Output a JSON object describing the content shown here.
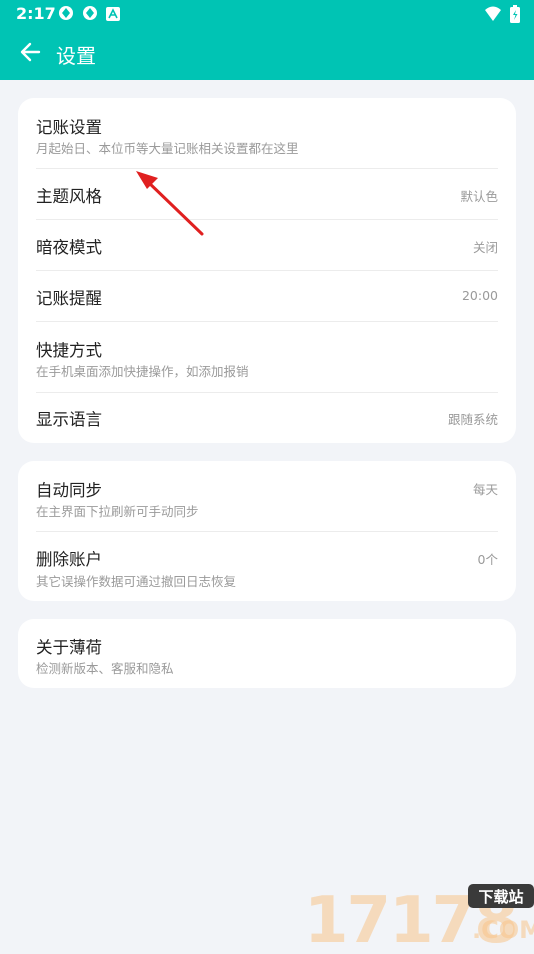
{
  "status_bar": {
    "time": "2:17",
    "left_icons": [
      "sync-icon",
      "sync-icon",
      "a-notification-icon"
    ],
    "right_icons": [
      "wifi-icon",
      "battery-icon"
    ]
  },
  "app_bar": {
    "title": "设置",
    "back_icon": "arrow-left-icon",
    "color": "#00c4b4"
  },
  "groups": [
    {
      "items": [
        {
          "title": "记账设置",
          "subtitle": "月起始日、本位币等大量记账相关设置都在这里",
          "value": ""
        },
        {
          "title": "主题风格",
          "subtitle": "",
          "value": "默认色"
        },
        {
          "title": "暗夜模式",
          "subtitle": "",
          "value": "关闭"
        },
        {
          "title": "记账提醒",
          "subtitle": "",
          "value": "20:00"
        },
        {
          "title": "快捷方式",
          "subtitle": "在手机桌面添加快捷操作，如添加报销",
          "value": ""
        },
        {
          "title": "显示语言",
          "subtitle": "",
          "value": "跟随系统"
        }
      ]
    },
    {
      "items": [
        {
          "title": "自动同步",
          "subtitle": "在主界面下拉刷新可手动同步",
          "value": "每天"
        },
        {
          "title": "删除账户",
          "subtitle": "其它误操作数据可通过撤回日志恢复",
          "value": "0个"
        }
      ]
    },
    {
      "items": [
        {
          "title": "关于薄荷",
          "subtitle": "检测新版本、客服和隐私",
          "value": ""
        }
      ]
    }
  ],
  "annotation": {
    "color": "#e02020"
  },
  "watermark": {
    "text": "17178",
    "badge": "下载站",
    "suffix": ".COM"
  }
}
